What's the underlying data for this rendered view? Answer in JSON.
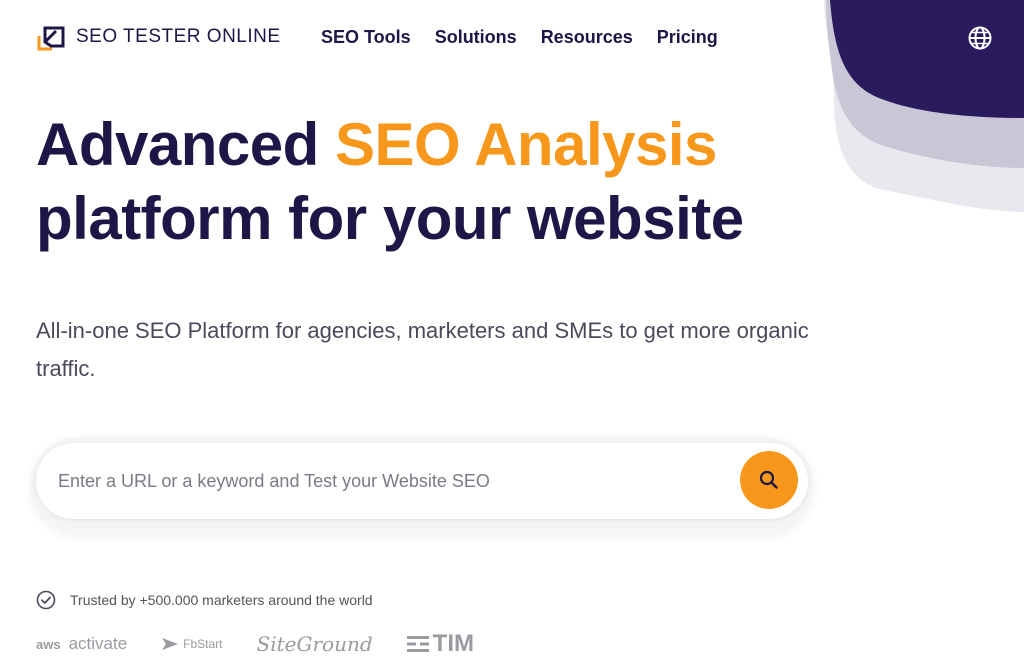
{
  "header": {
    "logo_text": "SEO TESTER ONLINE",
    "nav": [
      "SEO Tools",
      "Solutions",
      "Resources",
      "Pricing"
    ],
    "language_icon": "globe-icon"
  },
  "hero": {
    "title_part1": "Advanced ",
    "title_accent": "SEO Analysis",
    "title_part2": "platform for your website",
    "subtitle": "All-in-one SEO Platform for agencies, marketers and SMEs to get more organic traffic."
  },
  "search": {
    "placeholder": "Enter a URL or a keyword and Test your Website SEO",
    "value": "",
    "button_icon": "search-icon"
  },
  "trust": {
    "text": "Trusted by +500.000 marketers around the world",
    "icon": "check-circle-icon"
  },
  "partners": {
    "aws_prefix": "aws",
    "aws_name": "activate",
    "fbstart": "FbStart",
    "siteground": "SiteGround",
    "tim": "TIM"
  },
  "colors": {
    "primary": "#1c1746",
    "accent": "#f7981d",
    "blob_dark": "#2a1a5e",
    "blob_mid": "#c9c6d6",
    "blob_light": "#e9e8ee"
  }
}
